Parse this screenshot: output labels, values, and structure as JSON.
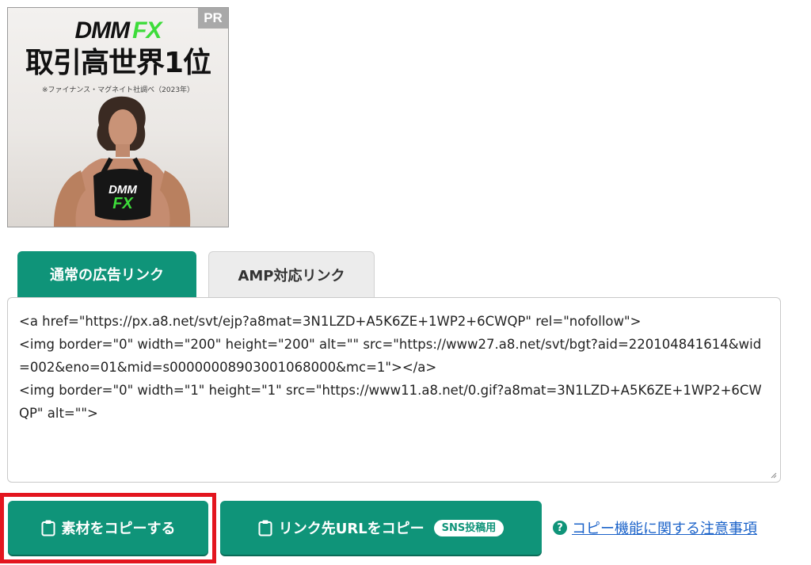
{
  "banner": {
    "pr_label": "PR",
    "brand_dmm": "DMM",
    "brand_fx": "FX",
    "headline": "取引高世界1位",
    "note": "※ファイナンス・マグネイト社調べ（2023年）",
    "shirt_dmm": "DMM",
    "shirt_fx": "FX"
  },
  "tabs": [
    {
      "label": "通常の広告リンク",
      "active": true
    },
    {
      "label": "AMP対応リンク",
      "active": false
    }
  ],
  "code": {
    "text": "<a href=\"https://px.a8.net/svt/ejp?a8mat=3N1LZD+A5K6ZE+1WP2+6CWQP\" rel=\"nofollow\">\n<img border=\"0\" width=\"200\" height=\"200\" alt=\"\" src=\"https://www27.a8.net/svt/bgt?aid=220104841614&wid=002&eno=01&mid=s00000008903001068000&mc=1\"></a>\n<img border=\"0\" width=\"1\" height=\"1\" src=\"https://www11.a8.net/0.gif?a8mat=3N1LZD+A5K6ZE+1WP2+6CWQP\" alt=\"\">"
  },
  "buttons": {
    "copy_material": "素材をコピーする",
    "copy_url": "リンク先URLをコピー",
    "sns_badge": "SNS投稿用"
  },
  "help": {
    "icon": "?",
    "link_text": "コピー機能に関する注意事項"
  },
  "colors": {
    "accent": "#0f9479",
    "highlight": "#e3161f",
    "link": "#1a62c9"
  }
}
